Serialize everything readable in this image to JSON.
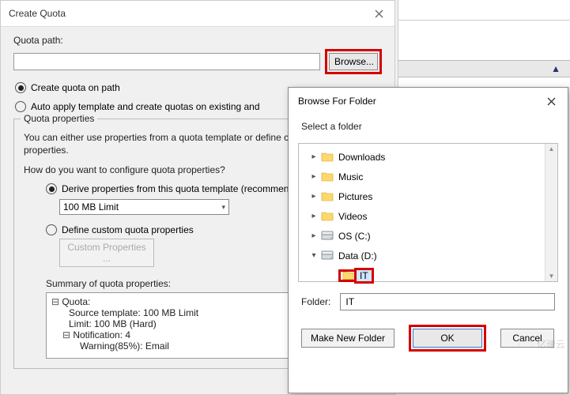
{
  "createQuota": {
    "title": "Create Quota",
    "pathLabel": "Quota path:",
    "pathValue": "",
    "browse": "Browse...",
    "radio1": "Create quota on path",
    "radio2": "Auto apply template and create quotas on existing and",
    "propsLegend": "Quota properties",
    "propsDesc": "You can either use properties from a quota template or define custom quota properties.",
    "question": "How do you want to configure quota properties?",
    "derive": "Derive properties from this quota template (recommended)",
    "template": "100 MB Limit",
    "define": "Define custom quota properties",
    "customBtn": "Custom Properties ...",
    "summaryLabel": "Summary of quota properties:",
    "summary": {
      "root": "Quota:",
      "line1": "Source template: 100 MB Limit",
      "line2": "Limit: 100 MB (Hard)",
      "notif": "Notification: 4",
      "warn": "Warning(85%): Email"
    }
  },
  "browseFolder": {
    "title": "Browse For Folder",
    "prompt": "Select a folder",
    "items": [
      {
        "label": "Downloads",
        "icon": "folder",
        "chevron": "right",
        "indent": 0
      },
      {
        "label": "Music",
        "icon": "folder",
        "chevron": "right",
        "indent": 0
      },
      {
        "label": "Pictures",
        "icon": "folder",
        "chevron": "right",
        "indent": 0
      },
      {
        "label": "Videos",
        "icon": "folder",
        "chevron": "right",
        "indent": 0
      },
      {
        "label": "OS (C:)",
        "icon": "drive",
        "chevron": "right",
        "indent": 0
      },
      {
        "label": "Data (D:)",
        "icon": "drive",
        "chevron": "down",
        "indent": 0
      },
      {
        "label": "IT",
        "icon": "folder",
        "chevron": "none",
        "indent": 1,
        "selected": true
      }
    ],
    "folderLabel": "Folder:",
    "folderValue": "IT",
    "makeNew": "Make New Folder",
    "ok": "OK",
    "cancel": "Cancel"
  },
  "watermark": "亿速云"
}
